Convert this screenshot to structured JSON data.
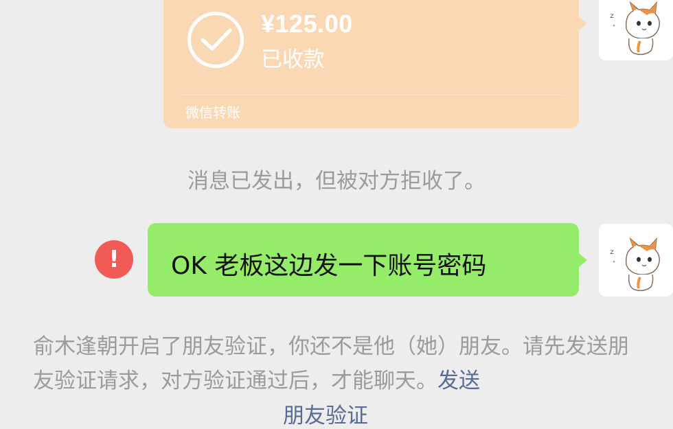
{
  "transfer": {
    "amount": "¥125.00",
    "status": "已收款",
    "brand": "微信转账",
    "card_color": "#fbd8b4"
  },
  "system_message": {
    "rejected": "消息已发出，但被对方拒收了。"
  },
  "outgoing_message": {
    "text": "OK 老板这边发一下账号密码",
    "bubble_color": "#95ec69",
    "error_icon": "exclamation-icon",
    "error_glyph": "!"
  },
  "friend_notice": {
    "text": "俞木逢朝开启了朋友验证，你还不是他（她）朋友。请先发送朋友验证请求，对方验证通过后，才能聊天。",
    "link_part1": "发送",
    "link_part2": "朋友验证",
    "link_color": "#576b95"
  },
  "avatar": {
    "icon": "cat-sticker-icon"
  }
}
